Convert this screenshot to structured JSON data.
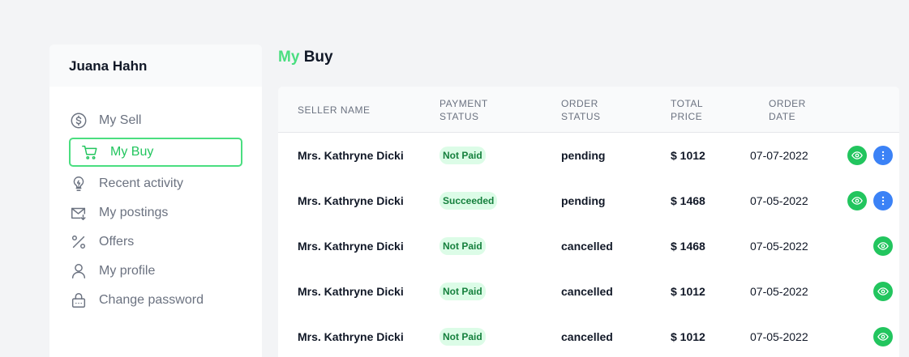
{
  "sidebar": {
    "user_name": "Juana Hahn",
    "items": [
      {
        "label": "My Sell",
        "icon": "dollar-circle-icon"
      },
      {
        "label": "My Buy",
        "icon": "cart-icon"
      },
      {
        "label": "Recent activity",
        "icon": "lightbulb-icon"
      },
      {
        "label": "My postings",
        "icon": "mail-icon"
      },
      {
        "label": "Offers",
        "icon": "percent-icon"
      },
      {
        "label": "My profile",
        "icon": "user-icon"
      },
      {
        "label": "Change password",
        "icon": "lock-icon"
      }
    ],
    "active_item": "My Buy"
  },
  "page": {
    "title_accent": "My",
    "title_rest": "Buy"
  },
  "table": {
    "columns": [
      {
        "line1": "Seller Name",
        "line2": ""
      },
      {
        "line1": "Payment",
        "line2": "Status"
      },
      {
        "line1": "Order",
        "line2": "Status"
      },
      {
        "line1": "Total",
        "line2": "Price"
      },
      {
        "line1": "Order",
        "line2": "Date"
      }
    ],
    "rows": [
      {
        "seller": "Mrs. Kathryne Dicki",
        "payment": "Not Paid",
        "order_status": "pending",
        "price": "$ 1012",
        "date": "07-07-2022",
        "actions": [
          "view",
          "more"
        ]
      },
      {
        "seller": "Mrs. Kathryne Dicki",
        "payment": "Succeeded",
        "order_status": "pending",
        "price": "$ 1468",
        "date": "07-05-2022",
        "actions": [
          "view",
          "more"
        ]
      },
      {
        "seller": "Mrs. Kathryne Dicki",
        "payment": "Not Paid",
        "order_status": "cancelled",
        "price": "$ 1468",
        "date": "07-05-2022",
        "actions": [
          "view"
        ]
      },
      {
        "seller": "Mrs. Kathryne Dicki",
        "payment": "Not Paid",
        "order_status": "cancelled",
        "price": "$ 1012",
        "date": "07-05-2022",
        "actions": [
          "view"
        ]
      },
      {
        "seller": "Mrs. Kathryne Dicki",
        "payment": "Not Paid",
        "order_status": "cancelled",
        "price": "$ 1012",
        "date": "07-05-2022",
        "actions": [
          "view"
        ]
      }
    ]
  },
  "colors": {
    "accent_green": "#4ade80",
    "view_button": "#22c55e",
    "more_button": "#3b82f6",
    "badge_bg": "#dcfce7",
    "badge_text": "#15803d"
  }
}
